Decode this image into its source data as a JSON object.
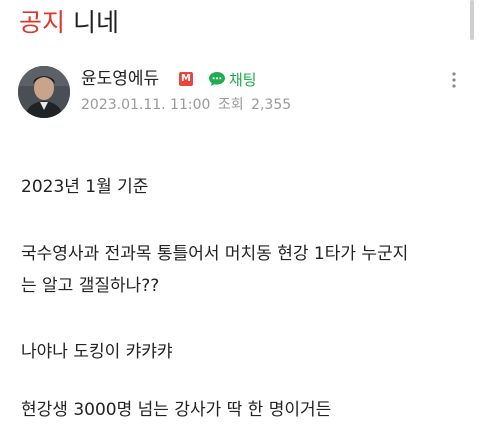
{
  "post": {
    "category_tag": "공지",
    "title": "니네"
  },
  "author": {
    "name": "윤도영에듀",
    "badge": "M",
    "chat_label": "채팅",
    "date": "2023.01.11. 11:00",
    "views_label": "조회",
    "views": "2,355"
  },
  "content": {
    "lines": [
      "2023년 1월 기준",
      "국수영사과 전과목 통틀어서 머치동 현강 1타가 누군지",
      "는 알고 갤질하나??",
      "나야나 도킹이 캬캬캬",
      "현강생 3000명 넘는 강사가 딱 한 명이거든"
    ]
  },
  "colors": {
    "category_tag": "#e0352b",
    "chat": "#1fae4d",
    "meta": "#9a9a9a",
    "badge": "#e8453c"
  },
  "icons": {
    "chat": "chat-bubble-icon",
    "more": "more-vertical-icon",
    "avatar": "avatar-photo"
  }
}
